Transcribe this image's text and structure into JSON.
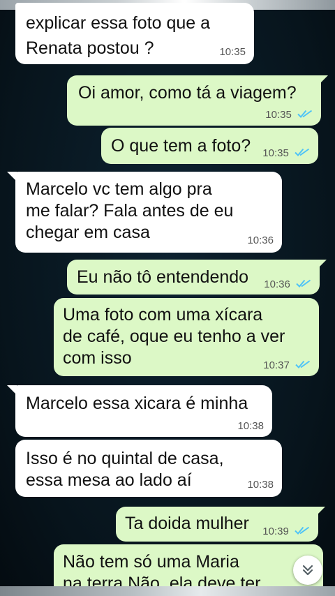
{
  "chat": {
    "messages": [
      {
        "direction": "in",
        "lines": [
          "explicar essa foto que a",
          "Renata postou ?"
        ],
        "time": "10:35"
      },
      {
        "direction": "out",
        "lines": [
          "Oi amor, como tá a viagem?"
        ],
        "time": "10:35",
        "status": "read"
      },
      {
        "direction": "out",
        "lines": [
          "O que tem a foto?"
        ],
        "time": "10:35",
        "status": "read"
      },
      {
        "direction": "in",
        "lines": [
          "Marcelo vc tem algo pra",
          "me falar? Fala antes de eu",
          "chegar em casa"
        ],
        "time": "10:36"
      },
      {
        "direction": "out",
        "lines": [
          "Eu não tô entendendo"
        ],
        "time": "10:36",
        "status": "read"
      },
      {
        "direction": "out",
        "lines": [
          "Uma foto com uma xícara",
          "de café, oque eu tenho a ver",
          "com isso"
        ],
        "time": "10:37",
        "status": "read"
      },
      {
        "direction": "in",
        "lines": [
          "Marcelo essa xicara é minha"
        ],
        "time": "10:38"
      },
      {
        "direction": "in",
        "lines": [
          "Isso é no quintal de casa,",
          "essa mesa ao lado aí"
        ],
        "time": "10:38"
      },
      {
        "direction": "out",
        "lines": [
          "Ta doida mulher"
        ],
        "time": "10:39",
        "status": "read"
      },
      {
        "direction": "out",
        "lines": [
          "Não tem só uma Maria",
          "na terra Não  ela deve ter"
        ],
        "time": "",
        "status": ""
      }
    ]
  },
  "colors": {
    "incoming_bubble": "#ffffff",
    "outgoing_bubble": "#dcf8c6",
    "read_ticks": "#4fc3f7",
    "background": "#07141c"
  },
  "icons": {
    "read_receipt": "double-check-icon",
    "scroll_down": "chevron-double-down-icon"
  }
}
